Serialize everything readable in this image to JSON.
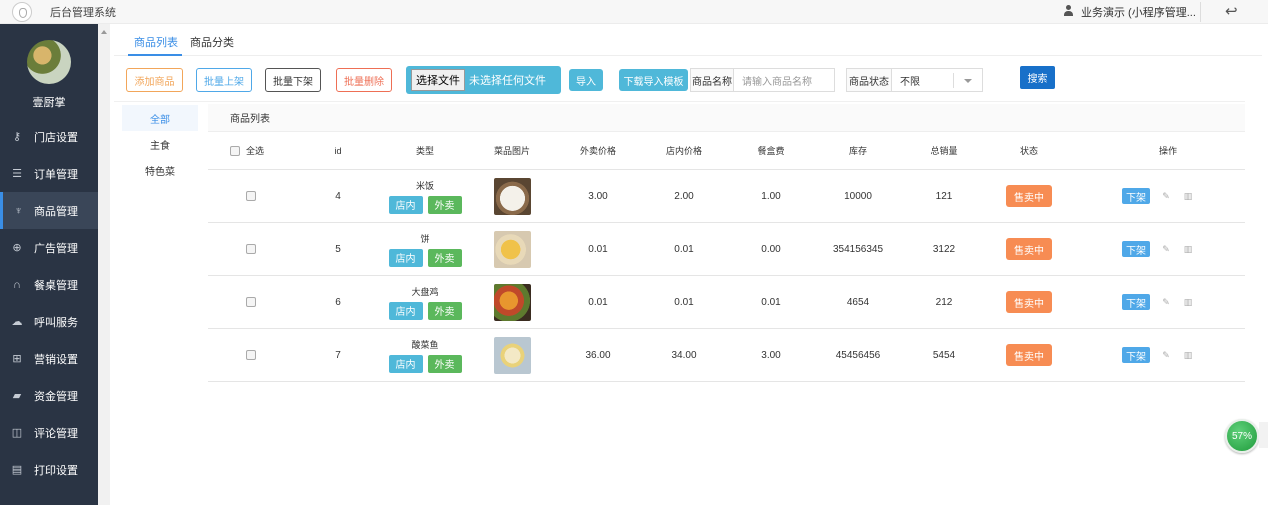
{
  "header": {
    "system_title": "后台管理系统",
    "user_label": "业务演示 (小程序管理..."
  },
  "sidebar": {
    "shop_name": "壹厨掌",
    "items": [
      {
        "label": "门店设置",
        "icon": "key-icon"
      },
      {
        "label": "订单管理",
        "icon": "menu-lines-icon"
      },
      {
        "label": "商品管理",
        "icon": "product-icon",
        "active": true
      },
      {
        "label": "广告管理",
        "icon": "globe-icon"
      },
      {
        "label": "餐桌管理",
        "icon": "binoculars-icon"
      },
      {
        "label": "呼叫服务",
        "icon": "cloud-icon"
      },
      {
        "label": "营销设置",
        "icon": "gift-icon"
      },
      {
        "label": "资金管理",
        "icon": "card-icon"
      },
      {
        "label": "评论管理",
        "icon": "camera-icon"
      },
      {
        "label": "打印设置",
        "icon": "print-icon"
      }
    ]
  },
  "tabs": [
    {
      "label": "商品列表",
      "active": true
    },
    {
      "label": "商品分类",
      "active": false
    }
  ],
  "toolbar": {
    "add_label": "添加商品",
    "batch_on_label": "批量上架",
    "batch_off_label": "批量下架",
    "batch_delete_label": "批量删除",
    "file_button_label": "选择文件",
    "file_status": "未选择任何文件",
    "import_label": "导入",
    "download_template_label": "下载导入模板",
    "name_label": "商品名称",
    "name_placeholder": "请输入商品名称",
    "status_label": "商品状态",
    "status_value": "不限",
    "search_label": "搜索"
  },
  "categories": [
    {
      "label": "全部",
      "active": true
    },
    {
      "label": "主食",
      "active": false
    },
    {
      "label": "特色菜",
      "active": false
    }
  ],
  "table": {
    "title": "商品列表",
    "select_all_label": "全选",
    "headers": {
      "id": "id",
      "type": "类型",
      "image": "菜品图片",
      "takeout_price": "外卖价格",
      "dinein_price": "店内价格",
      "box_fee": "餐盒费",
      "stock": "库存",
      "sales": "总销量",
      "status": "状态",
      "actions": "操作"
    },
    "tag_dinein": "店内",
    "tag_takeout": "外卖",
    "status_on_sale": "售卖中",
    "action_down": "下架",
    "rows": [
      {
        "id": "4",
        "name": "米饭",
        "takeout_price": "3.00",
        "dinein_price": "2.00",
        "box_fee": "1.00",
        "stock": "10000",
        "sales": "121"
      },
      {
        "id": "5",
        "name": "饼",
        "takeout_price": "0.01",
        "dinein_price": "0.01",
        "box_fee": "0.00",
        "stock": "354156345",
        "sales": "3122"
      },
      {
        "id": "6",
        "name": "大盘鸡",
        "takeout_price": "0.01",
        "dinein_price": "0.01",
        "box_fee": "0.01",
        "stock": "4654",
        "sales": "212"
      },
      {
        "id": "7",
        "name": "酸菜鱼",
        "takeout_price": "36.00",
        "dinein_price": "34.00",
        "box_fee": "3.00",
        "stock": "45456456",
        "sales": "5454"
      }
    ]
  },
  "widget": {
    "percent": "57%"
  }
}
